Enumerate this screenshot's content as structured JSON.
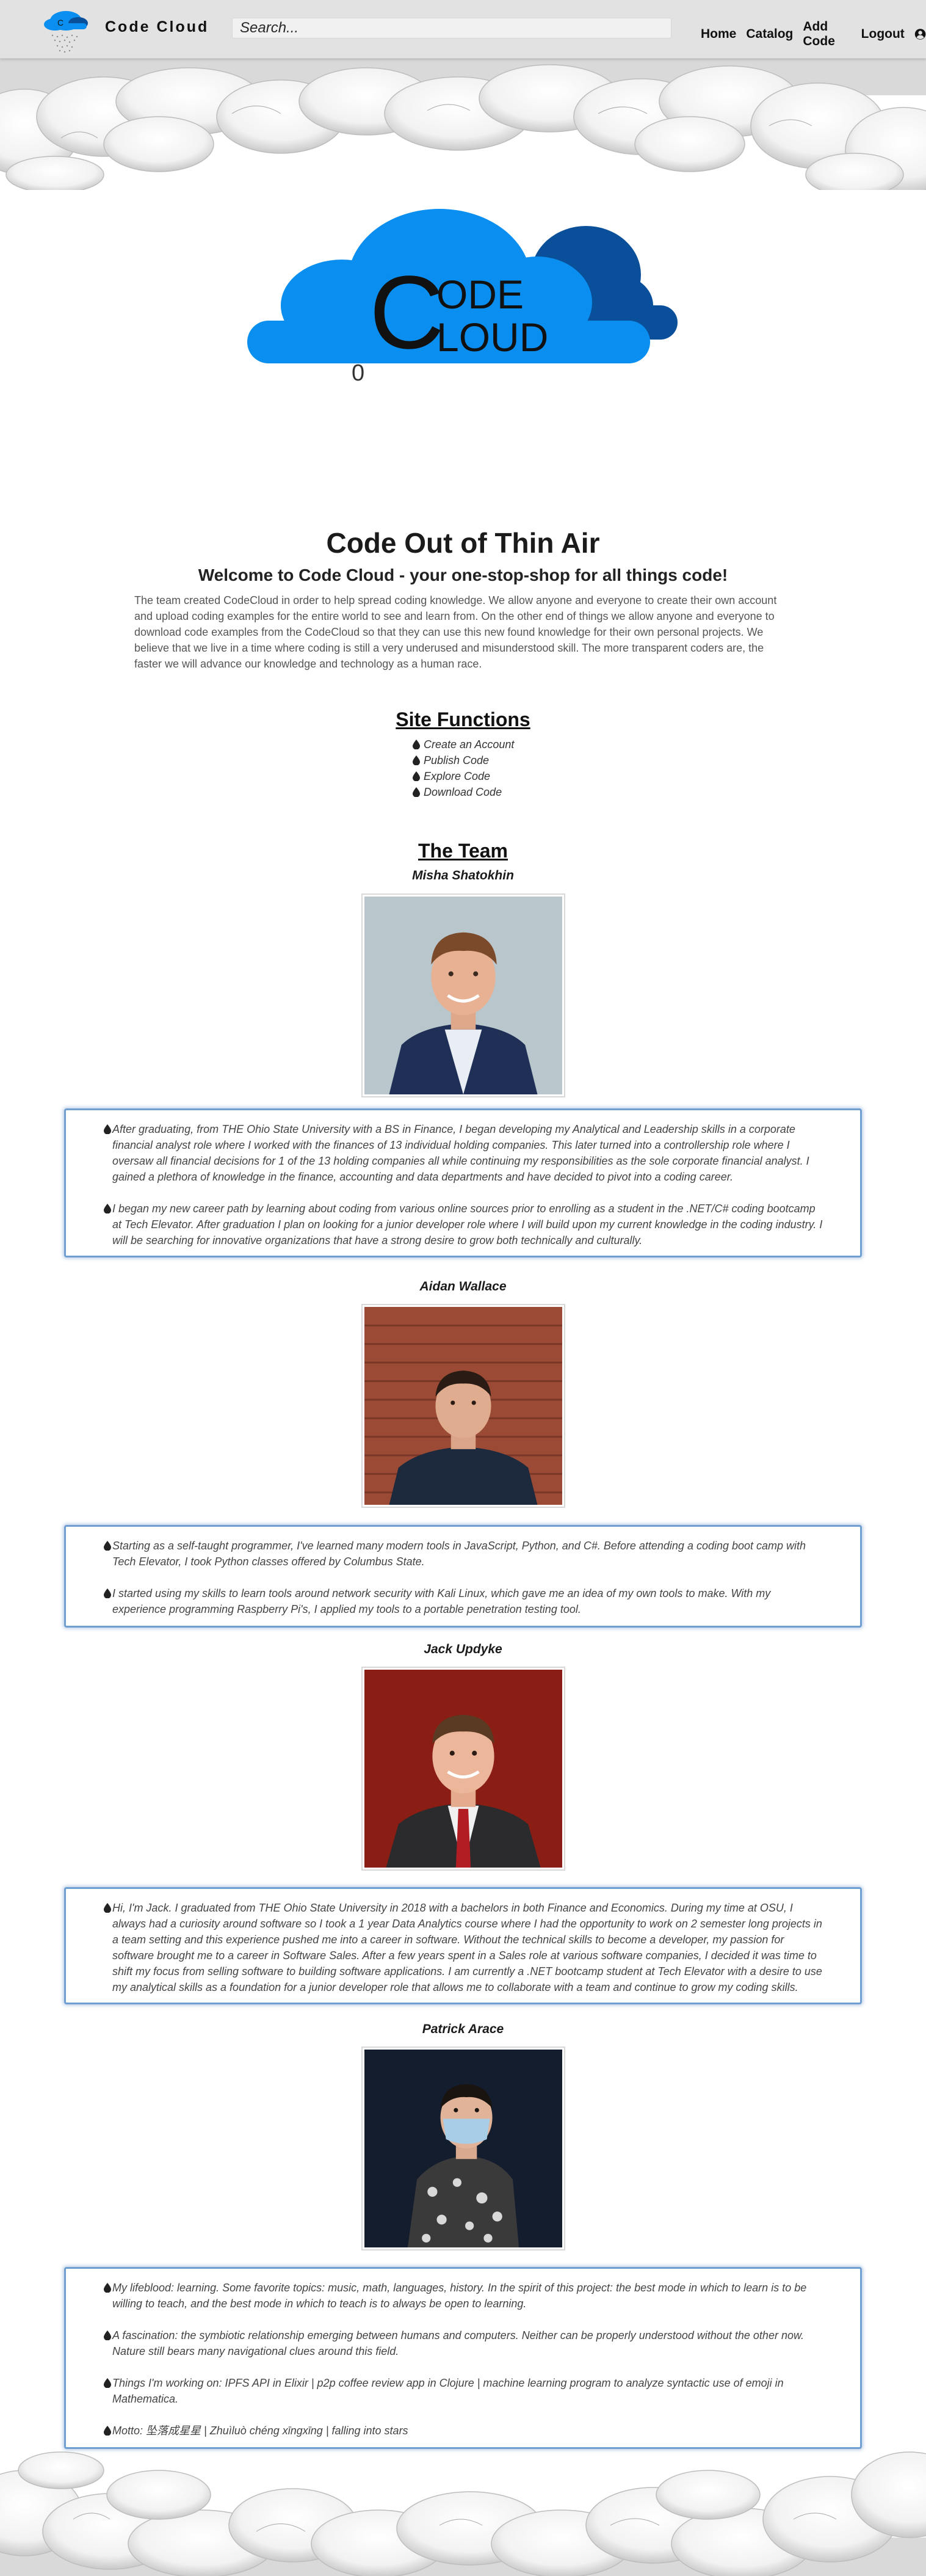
{
  "navbar": {
    "brand": "Code Cloud",
    "search_placeholder": "Search...",
    "links": [
      "Home",
      "Catalog",
      "Add Code",
      "Logout"
    ],
    "user_icon": "user-circle-icon"
  },
  "hero": {
    "logo_text_c": "C",
    "logo_text_ode": "ODE",
    "logo_text_loud": "LOUD",
    "counter": "0"
  },
  "intro": {
    "title": "Code Out of Thin Air",
    "subtitle": "Welcome to Code Cloud - your one-stop-shop for all things code!",
    "body": "The team created CodeCloud in order to help spread coding knowledge. We allow anyone and everyone to create their own account and upload coding examples for the entire world to see and learn from. On the other end of things we allow anyone and everyone to download code examples from the CodeCloud so that they can use this new found knowledge for their own personal projects. We believe that we live in a time where coding is still a very underused and misunderstood skill. The more transparent coders are, the faster we will advance our knowledge and technology as a human race."
  },
  "site_functions": {
    "heading": "Site Functions",
    "items": [
      "Create an Account",
      "Publish Code",
      "Explore Code",
      "Download Code"
    ]
  },
  "team": {
    "heading": "The Team",
    "members": [
      {
        "name": "Misha Shatokhin",
        "bio": [
          "After graduating, from THE Ohio State University with a BS in Finance, I began developing my Analytical and Leadership skills in a corporate financial analyst role where I worked with the finances of 13 individual holding companies. This later turned into a controllership role where I oversaw all financial decisions for 1 of the 13 holding companies all while continuing my responsibilities as the sole corporate financial analyst. I gained a plethora of knowledge in the finance, accounting and data departments and have decided to pivot into a coding career.",
          "I began my new career path by learning about coding from various online sources prior to enrolling as a student in the .NET/C# coding bootcamp at Tech Elevator. After graduation I plan on looking for a junior developer role where I will build upon my current knowledge in the coding industry. I will be searching for innovative organizations that have a strong desire to grow both technically and culturally."
        ]
      },
      {
        "name": "Aidan Wallace",
        "bio": [
          "Starting as a self-taught programmer, I've learned many modern tools in JavaScript, Python, and C#. Before attending a coding boot camp with Tech Elevator, I took Python classes offered by Columbus State.",
          "I started using my skills to learn tools around network security with Kali Linux, which gave me an idea of my own tools to make. With my experience programming Raspberry Pi's, I applied my tools to a portable penetration testing tool."
        ]
      },
      {
        "name": "Jack Updyke",
        "bio": [
          "Hi, I'm Jack. I graduated from THE Ohio State University in 2018 with a bachelors in both Finance and Economics. During my time at OSU, I always had a curiosity around software so I took a 1 year Data Analytics course where I had the opportunity to work on 2 semester long projects in a team setting and this experience pushed me into a career in software. Without the technical skills to become a developer, my passion for software brought me to a career in Software Sales. After a few years spent in a Sales role at various software companies, I decided it was time to shift my focus from selling software to building software applications. I am currently a .NET bootcamp student at Tech Elevator with a desire to use my analytical skills as a foundation for a junior developer role that allows me to collaborate with a team and continue to grow my coding skills."
        ]
      },
      {
        "name": "Patrick Arace",
        "bio": [
          "My lifeblood: learning. Some favorite topics: music, math, languages, history. In the spirit of this project: the best mode in which to learn is to be willing to teach, and the best mode in which to teach is to always be open to learning.",
          "A fascination: the symbiotic relationship emerging between humans and computers. Neither can be properly understood without the other now. Nature still bears many navigational clues around this field.",
          "Things I'm working on: IPFS API in Elixir | p2p coffee review app in Clojure | machine learning program to analyze syntactic use of emoji in Mathematica.",
          "Motto: 坠落成星星 | Zhuìluò chéng xīngxīng | falling into stars"
        ]
      }
    ]
  },
  "colors": {
    "navbar_bg": "#e2e2e2",
    "cloud_light": "#0a8ff0",
    "cloud_dark": "#0a4f99",
    "bio_border": "#6f9fd0"
  }
}
